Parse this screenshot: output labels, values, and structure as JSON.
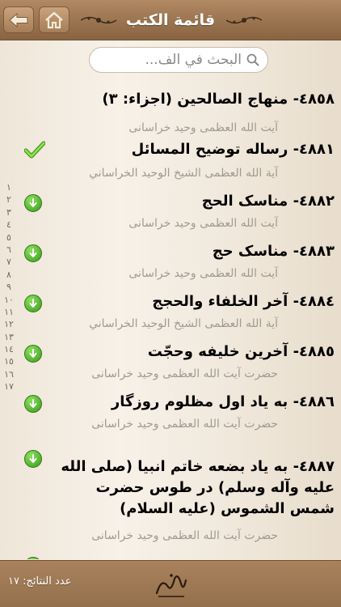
{
  "header": {
    "title": "قائمة الكتب",
    "back_icon": "back-arrow-icon",
    "home_icon": "home-icon"
  },
  "search": {
    "placeholder": "البحث في الف..."
  },
  "books": [
    {
      "title": "٤٨٥٨- منهاج الصالحين (اجزاء: ٣)",
      "author": "آيت الله العظمی وحيد خراسانی",
      "status": "none"
    },
    {
      "title": "٤٨٨١- رساله توضيح المسائل",
      "author": "آية الله العظمى الشيخ الوحيد الخراساني",
      "status": "downloaded"
    },
    {
      "title": "٤٨٨٢- مناسک الحج",
      "author": "آيت الله العظمی وحيد خراسانی",
      "status": "download"
    },
    {
      "title": "٤٨٨٣- مناسک حج",
      "author": "آيت الله العظمی وحيد خراسانی",
      "status": "download"
    },
    {
      "title": "٤٨٨٤- آخر الخلفاء والحجج",
      "author": "آية الله العظمى الشيخ الوحيد الخراساني",
      "status": "download"
    },
    {
      "title": "٤٨٨٥- آخرين خليفه وحجّت",
      "author": "حضرت آيت الله العظمی وحيد خراسانی",
      "status": "download"
    },
    {
      "title": "٤٨٨٦- به ياد اول مظلوم روزگار",
      "author": "حضرت آيت الله العظمی وحيد خراسانی",
      "status": "download"
    },
    {
      "title": "٤٨٨٧- به ياد بضعه خاتم انبيا (صلی الله عليه وآله وسلم) در طوس حضرت شمس الشموس (عليه السلام)",
      "author": "حضرت آيت الله العظمی وحيد خراسانی",
      "status": "download"
    }
  ],
  "index_bar": [
    "١",
    "٢",
    "٣",
    "٤",
    "٥",
    "٦",
    "٧",
    "٨",
    "٩",
    "١٠",
    "١١",
    "١٢",
    "١٣",
    "١٤",
    "١٥",
    "١٦",
    "١٧"
  ],
  "footer": {
    "results_label": "عدد النتائج: ١٧",
    "logo_icon": "calligraphy-logo-icon"
  },
  "colors": {
    "header_brown": "#9a7450",
    "download_green": "#3b9a1d",
    "check_green": "#6fc72b",
    "author_gray": "#a09a93"
  }
}
